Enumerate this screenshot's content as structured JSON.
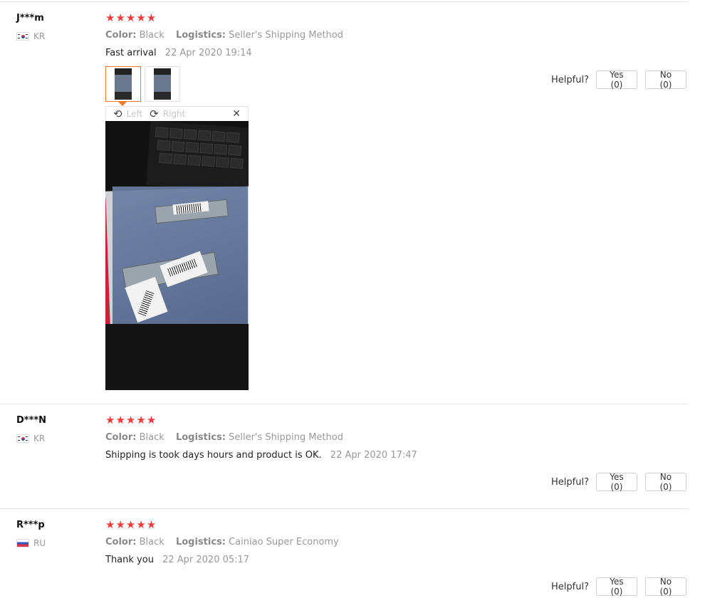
{
  "reviews": [
    {
      "user": "J***m",
      "country": "KR",
      "rating": 5,
      "stars": "★★★★★",
      "color_label": "Color:",
      "color_value": "Black",
      "logistics_label": "Logistics:",
      "logistics_value": "Seller's Shipping Method",
      "text": "Fast arrival",
      "date": "22 Apr 2020 19:14",
      "helpful_label": "Helpful?",
      "yes_label": "Yes (0)",
      "no_label": "No (0)",
      "viewer": {
        "rotate_left_label": "Left",
        "rotate_right_label": "Right",
        "close_icon": "✕"
      }
    },
    {
      "user": "D***N",
      "country": "KR",
      "rating": 5,
      "stars": "★★★★★",
      "color_label": "Color:",
      "color_value": "Black",
      "logistics_label": "Logistics:",
      "logistics_value": "Seller's Shipping Method",
      "text": "Shipping is took days hours and product is OK.",
      "date": "22 Apr 2020 17:47",
      "helpful_label": "Helpful?",
      "yes_label": "Yes (0)",
      "no_label": "No (0)"
    },
    {
      "user": "R***p",
      "country": "RU",
      "rating": 5,
      "stars": "★★★★★",
      "color_label": "Color:",
      "color_value": "Black",
      "logistics_label": "Logistics:",
      "logistics_value": "Cainiao Super Economy",
      "text": "Thank you",
      "date": "22 Apr 2020 05:17",
      "helpful_label": "Helpful?",
      "yes_label": "Yes (0)",
      "no_label": "No (0)"
    }
  ],
  "colors": {
    "star": "#ef3b3b",
    "active_thumb": "#f07c2b",
    "muted": "#999999"
  },
  "icons": {
    "rotate_left": "rotate-left-icon",
    "rotate_right": "rotate-right-icon",
    "close": "close-icon",
    "star": "star-icon"
  }
}
